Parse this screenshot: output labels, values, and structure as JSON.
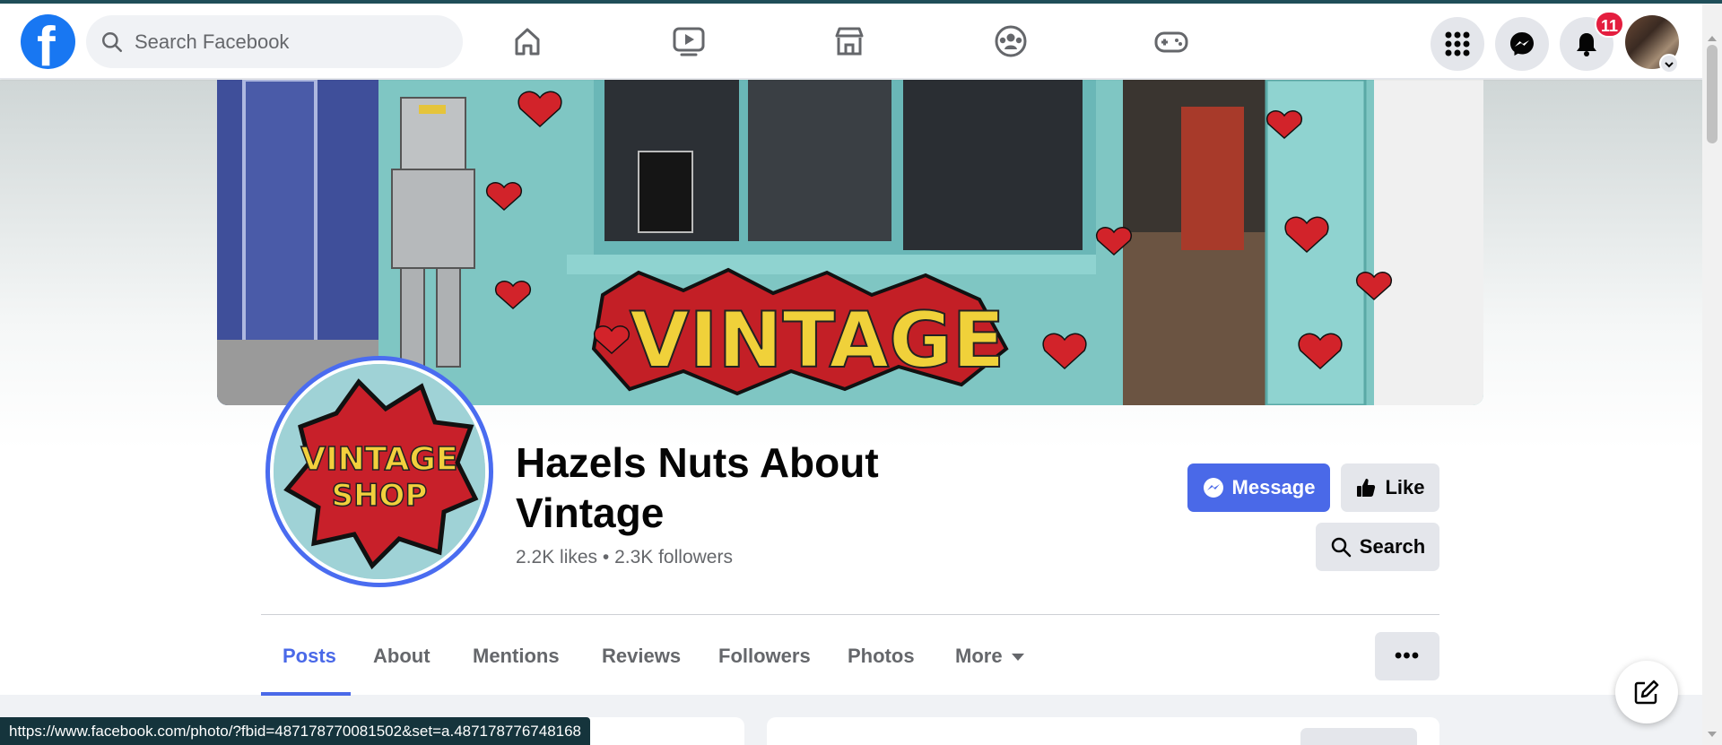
{
  "topbar": {
    "logo_letter": "f",
    "search_placeholder": "Search Facebook",
    "nav_icons": [
      "home-icon",
      "watch-icon",
      "marketplace-icon",
      "groups-icon",
      "gaming-icon"
    ],
    "right_icons": [
      "menu-grid-icon",
      "messenger-icon",
      "notifications-icon"
    ],
    "notification_count": "11"
  },
  "page": {
    "name": "Hazels Nuts About Vintage",
    "stats": "2.2K likes • 2.3K followers",
    "cover_sign_text": "VINTAGE",
    "profile_text_line1": "VINTAGE",
    "profile_text_line2": "SHOP"
  },
  "actions": {
    "message": "Message",
    "like": "Like",
    "search": "Search",
    "more_dots": "•••"
  },
  "tabs": [
    {
      "label": "Posts",
      "active": true
    },
    {
      "label": "About"
    },
    {
      "label": "Mentions"
    },
    {
      "label": "Reviews"
    },
    {
      "label": "Followers"
    },
    {
      "label": "Photos"
    },
    {
      "label": "More"
    }
  ],
  "status_bar": {
    "url": "https://www.facebook.com/photo/?fbid=487178770081502&set=a.487178776748168"
  },
  "colors": {
    "accent": "#4a69e8",
    "facebook_blue": "#1877f2",
    "badge_red": "#e41e3f"
  }
}
